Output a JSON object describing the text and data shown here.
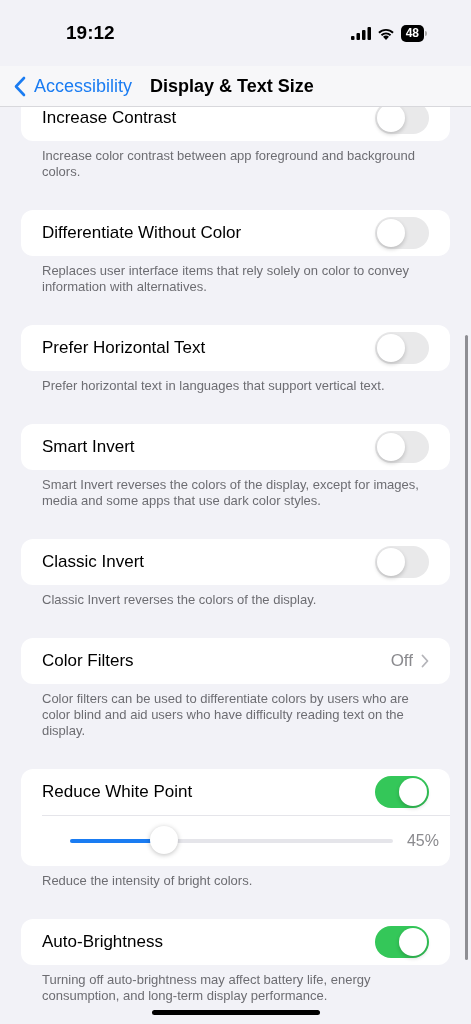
{
  "status_bar": {
    "time": "19:12",
    "battery": "48"
  },
  "nav": {
    "back": "Accessibility",
    "title": "Display & Text Size"
  },
  "settings": [
    {
      "kind": "toggle",
      "label": "Increase Contrast",
      "on": false,
      "footer": "Increase color contrast between app foreground and background colors."
    },
    {
      "kind": "toggle",
      "label": "Differentiate Without Color",
      "on": false,
      "footer": "Replaces user interface items that rely solely on color to convey information with alternatives."
    },
    {
      "kind": "toggle",
      "label": "Prefer Horizontal Text",
      "on": false,
      "footer": "Prefer horizontal text in languages that support vertical text."
    },
    {
      "kind": "toggle",
      "label": "Smart Invert",
      "on": false,
      "footer": "Smart Invert reverses the colors of the display, except for images, media and some apps that use dark color styles."
    },
    {
      "kind": "toggle",
      "label": "Classic Invert",
      "on": false,
      "footer": "Classic Invert reverses the colors of the display."
    },
    {
      "kind": "link",
      "label": "Color Filters",
      "value": "Off",
      "footer": "Color filters can be used to differentiate colors by users who are color blind and aid users who have difficulty reading text on the display."
    },
    {
      "kind": "toggle",
      "label": "Reduce White Point",
      "on": true,
      "slider": {
        "level": 0.29,
        "reading": "45%"
      },
      "footer": "Reduce the intensity of bright colors."
    },
    {
      "kind": "toggle",
      "label": "Auto-Brightness",
      "on": true,
      "footer": "Turning off auto-brightness may affect battery life, energy consumption, and long-term display performance."
    }
  ]
}
